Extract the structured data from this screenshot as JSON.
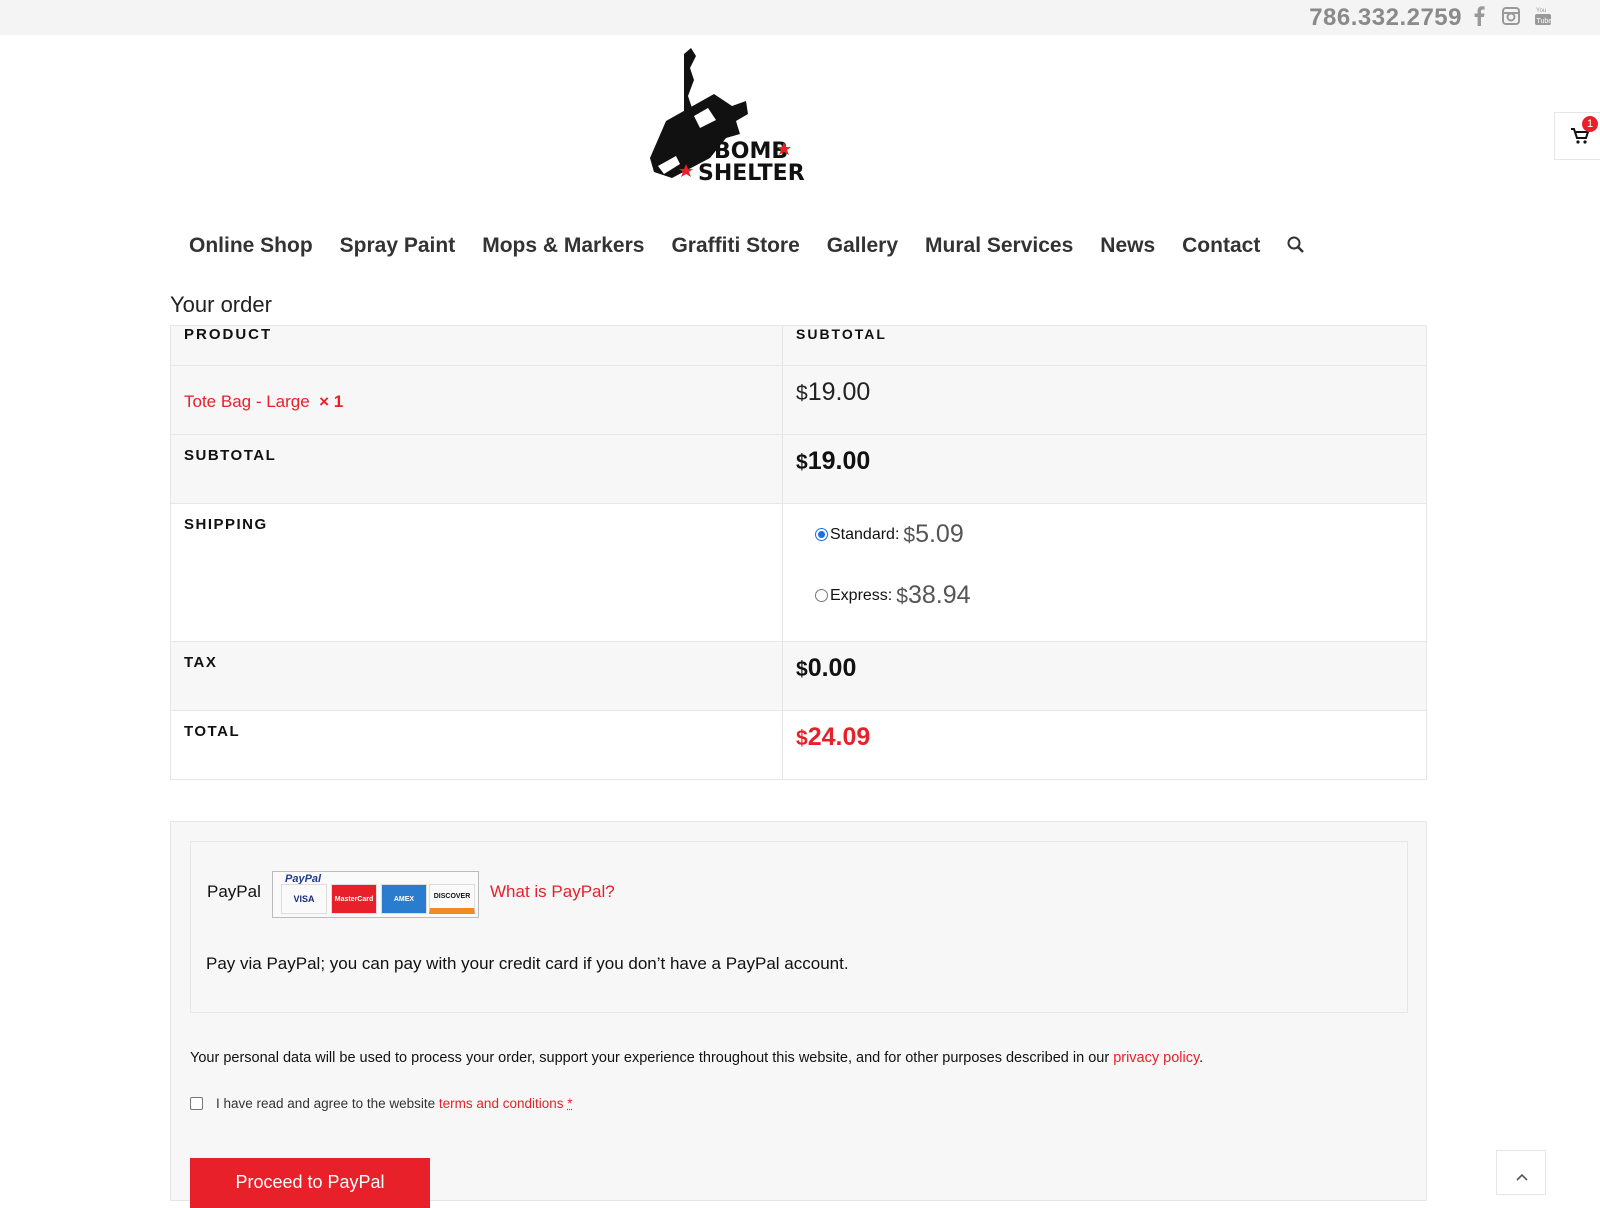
{
  "topbar": {
    "phone": "786.332.2759"
  },
  "social": [
    "facebook-icon",
    "instagram-icon",
    "youtube-icon"
  ],
  "brand": {
    "logo_text": "BOMB SHELTER",
    "logo_line1": "BOMB",
    "logo_line2": "SHELTER"
  },
  "cart": {
    "count": "1"
  },
  "nav": {
    "items": [
      "Online Shop",
      "Spray Paint",
      "Mops & Markers",
      "Graffiti Store",
      "Gallery",
      "Mural Services",
      "News",
      "Contact"
    ]
  },
  "order": {
    "title": "Your order",
    "col_product": "PRODUCT",
    "col_subtotal": "SUBTOTAL",
    "item": {
      "name": "Tote Bag - Large",
      "qty": "× 1",
      "price": "19.00"
    },
    "subtotal_label": "SUBTOTAL",
    "subtotal_value": "19.00",
    "shipping_label": "SHIPPING",
    "shipping_options": [
      {
        "label": "Standard:",
        "amount": "5.09",
        "selected": true
      },
      {
        "label": "Express:",
        "amount": "38.94",
        "selected": false
      }
    ],
    "tax_label": "TAX",
    "tax_value": "0.00",
    "total_label": "TOTAL",
    "total_value": "24.09",
    "currency": "$"
  },
  "payment": {
    "method": "PayPal",
    "paypal_brand": "PayPal",
    "cards": [
      "VISA",
      "MasterCard",
      "AMEX",
      "DISCOVER"
    ],
    "what_link": "What is PayPal?",
    "description": "Pay via PayPal; you can pay with your credit card if you don’t have a PayPal account.",
    "privacy_text": "Your personal data will be used to process your order, support your experience throughout this website, and for other purposes described in our",
    "privacy_link": "privacy policy",
    "privacy_end": ".",
    "terms_text": "I have read and agree to the website",
    "terms_link": "terms and conditions",
    "terms_required": "*",
    "proceed_label": "Proceed to PayPal"
  },
  "colors": {
    "accent": "#e8202a",
    "phone": "#8a8a8a",
    "radio": "#1a6fe3"
  }
}
